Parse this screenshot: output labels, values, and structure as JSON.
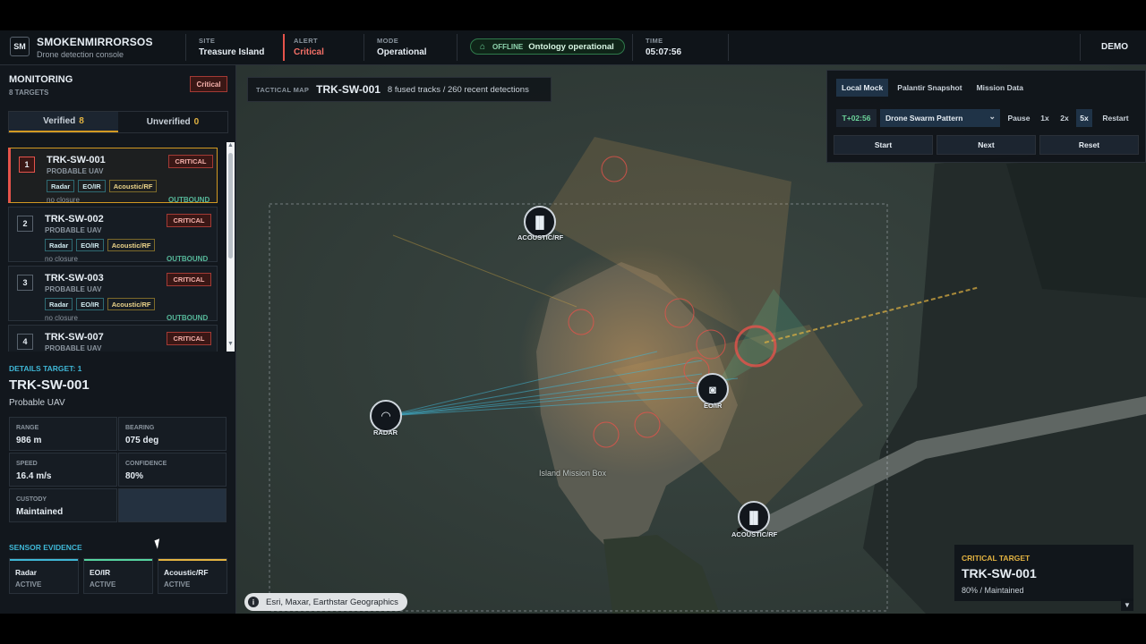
{
  "header": {
    "logo": "SM",
    "app_name": "SMOKENMIRRORSOS",
    "app_subtitle": "Drone detection console",
    "site_label": "SITE",
    "site_value": "Treasure Island",
    "alert_label": "ALERT",
    "alert_value": "Critical",
    "mode_label": "MODE",
    "mode_value": "Operational",
    "status_offline": "OFFLINE",
    "status_text": "Ontology operational",
    "time_label": "TIME",
    "time_value": "05:07:56",
    "demo": "DEMO"
  },
  "sidebar": {
    "title": "MONITORING",
    "subtitle": "8 TARGETS",
    "alert_badge": "Critical",
    "tabs": [
      {
        "label": "Verified",
        "count": "8"
      },
      {
        "label": "Unverified",
        "count": "0"
      }
    ],
    "targets": [
      {
        "num": "1",
        "id": "TRK-SW-001",
        "type": "PROBABLE UAV",
        "badge": "CRITICAL",
        "chips": [
          "Radar",
          "EO/IR",
          "Acoustic/RF"
        ],
        "closure": "no closure",
        "direction": "OUTBOUND"
      },
      {
        "num": "2",
        "id": "TRK-SW-002",
        "type": "PROBABLE UAV",
        "badge": "CRITICAL",
        "chips": [
          "Radar",
          "EO/IR",
          "Acoustic/RF"
        ],
        "closure": "no closure",
        "direction": "OUTBOUND"
      },
      {
        "num": "3",
        "id": "TRK-SW-003",
        "type": "PROBABLE UAV",
        "badge": "CRITICAL",
        "chips": [
          "Radar",
          "EO/IR",
          "Acoustic/RF"
        ],
        "closure": "no closure",
        "direction": "OUTBOUND"
      },
      {
        "num": "4",
        "id": "TRK-SW-007",
        "type": "PROBABLE UAV",
        "badge": "CRITICAL",
        "chips": [],
        "closure": "",
        "direction": ""
      }
    ],
    "details": {
      "label": "DETAILS TARGET: 1",
      "id": "TRK-SW-001",
      "type": "Probable UAV",
      "fields": [
        {
          "label": "RANGE",
          "value": "986 m"
        },
        {
          "label": "BEARING",
          "value": "075 deg"
        },
        {
          "label": "SPEED",
          "value": "16.4 m/s"
        },
        {
          "label": "CONFIDENCE",
          "value": "80%"
        },
        {
          "label": "CUSTODY",
          "value": "Maintained"
        }
      ]
    },
    "sensor_evidence": {
      "label": "SENSOR EVIDENCE",
      "sensors": [
        {
          "name": "Radar",
          "status": "ACTIVE",
          "color": "#3fb7d6"
        },
        {
          "name": "EO/IR",
          "status": "ACTIVE",
          "color": "#56d4a0"
        },
        {
          "name": "Acoustic/RF",
          "status": "ACTIVE",
          "color": "#e3b341"
        }
      ]
    }
  },
  "map": {
    "label": "TACTICAL MAP",
    "track_id": "TRK-SW-001",
    "summary": "8 fused tracks / 260 recent detections",
    "sensors": [
      {
        "name": "ACOUSTIC/RF",
        "icon": "waveform-icon"
      },
      {
        "name": "RADAR",
        "icon": "radar-gauge-icon"
      },
      {
        "name": "EO/IR",
        "icon": "camera-icon"
      },
      {
        "name": "ACOUSTIC/RF",
        "icon": "waveform-icon"
      }
    ],
    "area_label": "Island Mission Box",
    "attribution": "Esri, Maxar, Earthstar Geographics",
    "controls": {
      "sources": [
        "Local Mock",
        "Palantir Snapshot",
        "Mission Data"
      ],
      "time_offset": "T+02:56",
      "scenario": "Drone Swarm Pattern",
      "playback": [
        "Pause",
        "1x",
        "2x",
        "5x",
        "Restart"
      ],
      "actions": [
        "Start",
        "Next",
        "Reset"
      ]
    },
    "critical": {
      "label": "CRITICAL TARGET",
      "id": "TRK-SW-001",
      "status": "80% / Maintained"
    }
  },
  "colors": {
    "critical": "#e5534b",
    "accent_cyan": "#3fb7d6",
    "accent_amber": "#e3b341",
    "ok_green": "#6cd39a"
  }
}
